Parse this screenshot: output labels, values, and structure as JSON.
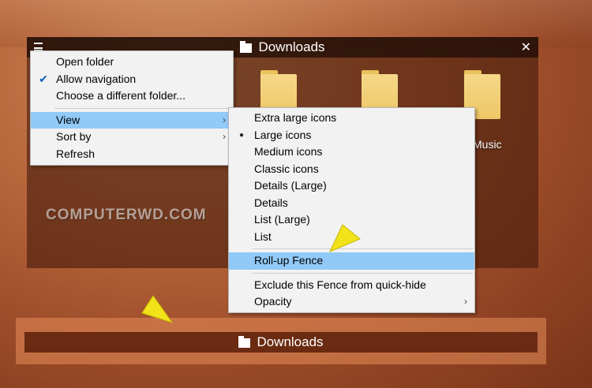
{
  "fence": {
    "title": "Downloads",
    "folders": [
      {
        "label": ""
      },
      {
        "label": ""
      },
      {
        "label": "Music"
      }
    ]
  },
  "watermark": "COMPUTERWD.COM",
  "context_menu": {
    "items": [
      {
        "label": "Open folder",
        "checked": false,
        "submenu": false
      },
      {
        "label": "Allow navigation",
        "checked": true,
        "submenu": false
      },
      {
        "label": "Choose a different folder...",
        "checked": false,
        "submenu": false
      },
      {
        "label": "View",
        "checked": false,
        "submenu": true,
        "highlighted": true
      },
      {
        "label": "Sort by",
        "checked": false,
        "submenu": true
      },
      {
        "label": "Refresh",
        "checked": false,
        "submenu": false
      }
    ]
  },
  "view_submenu": {
    "items": [
      {
        "label": "Extra large icons"
      },
      {
        "label": "Large icons",
        "selected": true
      },
      {
        "label": "Medium icons"
      },
      {
        "label": "Classic icons"
      },
      {
        "label": "Details (Large)"
      },
      {
        "label": "Details"
      },
      {
        "label": "List (Large)"
      },
      {
        "label": "List"
      }
    ],
    "rollup": "Roll-up Fence",
    "exclude": "Exclude this Fence from quick-hide",
    "opacity": "Opacity"
  },
  "rolled_fence": {
    "title": "Downloads"
  },
  "icons": {
    "check": "✔",
    "bullet": "●",
    "submenu_arrow": "›",
    "close": "✕"
  },
  "colors": {
    "highlight": "#91c9f7",
    "pointer": "#f2e21a"
  }
}
